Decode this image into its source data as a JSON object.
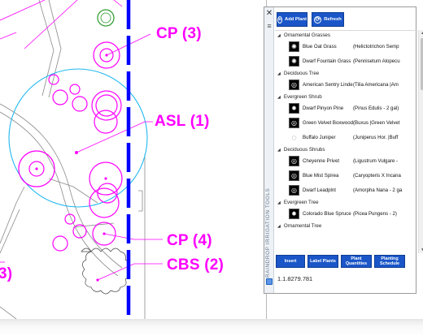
{
  "drawing": {
    "labels": [
      {
        "id": "cp3",
        "text": "CP (3)"
      },
      {
        "id": "asl1",
        "text": "ASL (1)"
      },
      {
        "id": "cp4",
        "text": "CP (4)"
      },
      {
        "id": "cbs2",
        "text": "CBS (2)"
      },
      {
        "id": "partial",
        "text": "3)"
      }
    ],
    "colors": {
      "annotation": "#ff00ff",
      "selection": "#00b4ff",
      "centerline": "#0000ff",
      "linework": "#7a7a7a"
    }
  },
  "palette": {
    "title": "RAINDROP IRRIGATION TOOLS",
    "close_icon": "close-icon",
    "add_plant_label": "Add Plant",
    "refresh_label": "Refresh",
    "groups": [
      {
        "name": "Ornamental Grasses",
        "items": [
          {
            "name": "Blue Oat Grass",
            "sci": "(Helictotrichon Semp",
            "thumb": "✺"
          },
          {
            "name": "Dwarf Fountain Grass",
            "sci": "(Pennisetum Alopecu",
            "thumb": "✺"
          }
        ]
      },
      {
        "name": "Deciduous Tree",
        "items": [
          {
            "name": "American Sentry Linden",
            "sci": "(Tilia Americana |Am",
            "thumb": "◎"
          }
        ]
      },
      {
        "name": "Evergreen Shrub",
        "items": [
          {
            "name": "Dwarf Pinyon Pine",
            "sci": "(Pinus Edulis - 2 gal)",
            "thumb": "✹"
          },
          {
            "name": "Green Velvet Boxwood",
            "sci": "(Buxus |Green Velvet",
            "thumb": "◎"
          },
          {
            "name": "Buffalo Juniper",
            "sci": "(Juniperus Hor. |Buff",
            "thumb": "◌"
          }
        ]
      },
      {
        "name": "Deciduous Shrubs",
        "items": [
          {
            "name": "Cheyenne Privet",
            "sci": "(Ligustrum Vulgare -",
            "thumb": "◎"
          },
          {
            "name": "Blue Mist Spirea",
            "sci": "(Caryopteris X Incana",
            "thumb": "◎"
          },
          {
            "name": "Dwarf Leadplnt",
            "sci": "(Amorpha Nana - 2 ga",
            "thumb": "◎"
          }
        ]
      },
      {
        "name": "Evergreen Tree",
        "items": [
          {
            "name": "Colorado Blue Spruce",
            "sci": "(Picea Pungens - 2)",
            "thumb": "✹"
          }
        ]
      },
      {
        "name": "Ornamental Tree",
        "items": []
      }
    ],
    "buttons": {
      "insert": "Insert",
      "label_plants": "Label Plants",
      "plant_quantities": "Plant Quantities",
      "planting_schedule": "Planting Schedule"
    },
    "version": "1.1.8279.781"
  }
}
